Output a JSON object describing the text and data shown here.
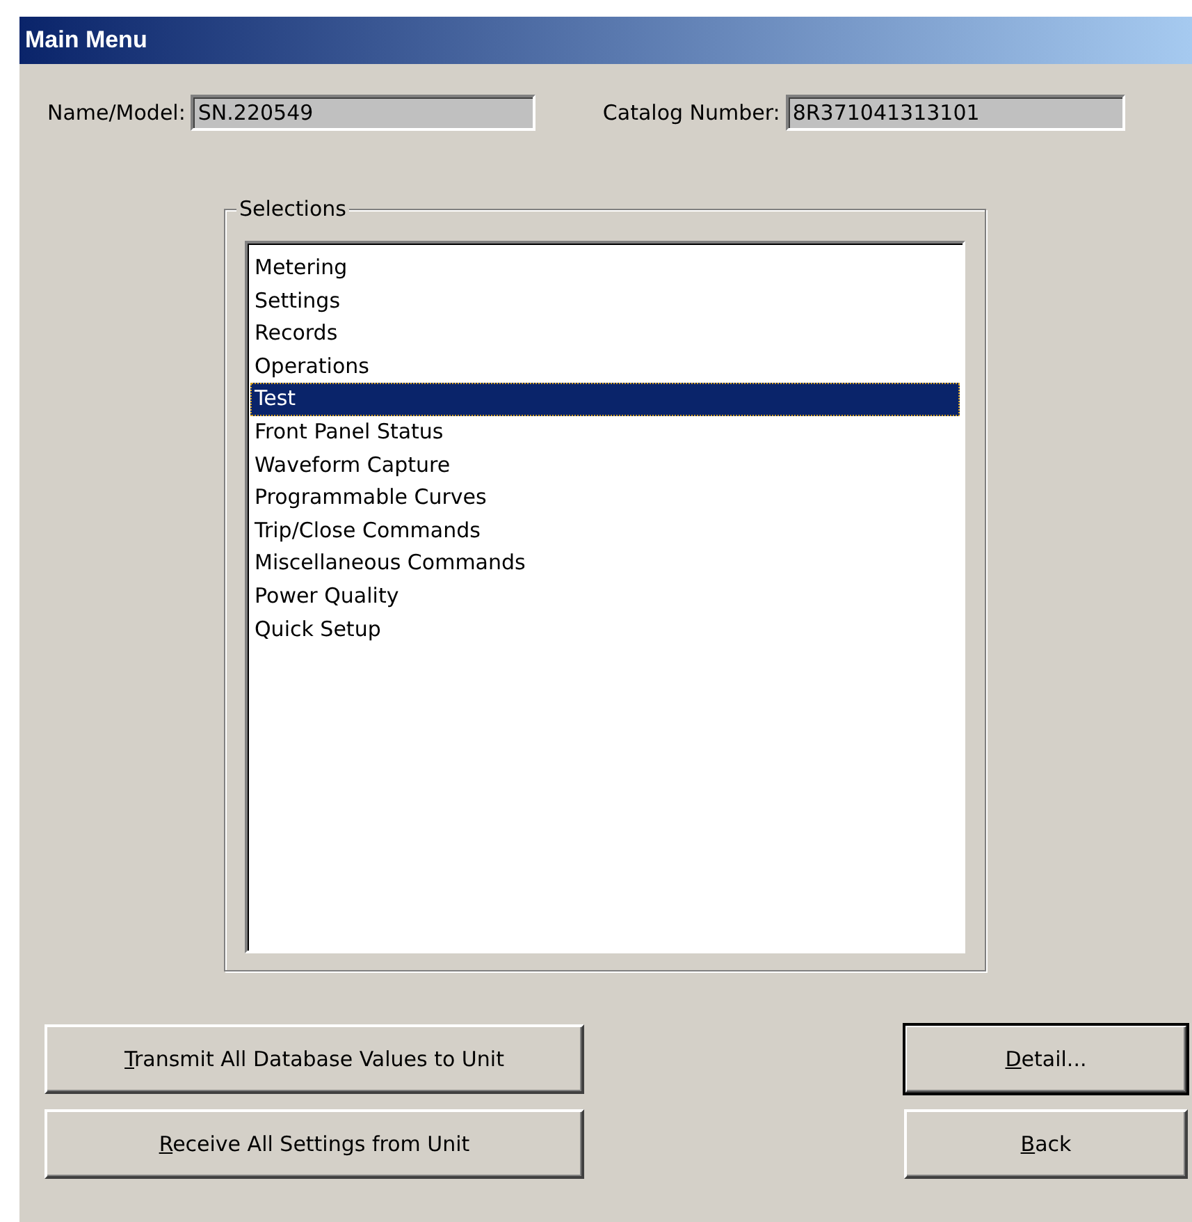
{
  "window": {
    "title": "Main Menu"
  },
  "fields": [
    {
      "label": "Name/Model:",
      "value": "SN.220549"
    },
    {
      "label": "Catalog Number:",
      "value": "8R371041313101"
    }
  ],
  "selections": {
    "title": "Selections",
    "items": [
      {
        "label": "Metering",
        "selected": false
      },
      {
        "label": "Settings",
        "selected": false
      },
      {
        "label": "Records",
        "selected": false
      },
      {
        "label": "Operations",
        "selected": false
      },
      {
        "label": "Test",
        "selected": true
      },
      {
        "label": "Front Panel Status",
        "selected": false
      },
      {
        "label": "Waveform Capture",
        "selected": false
      },
      {
        "label": "Programmable Curves",
        "selected": false
      },
      {
        "label": "Trip/Close Commands",
        "selected": false
      },
      {
        "label": "Miscellaneous Commands",
        "selected": false
      },
      {
        "label": "Power Quality",
        "selected": false
      },
      {
        "label": "Quick Setup",
        "selected": false
      }
    ]
  },
  "buttons": [
    {
      "label": "Transmit All Database Values to Unit",
      "mnemonic_first_letter": true,
      "default": false
    },
    {
      "label": "Detail...",
      "mnemonic_first_letter": true,
      "default": true
    },
    {
      "label": "Receive All Settings from Unit",
      "mnemonic_first_letter": true,
      "default": false
    },
    {
      "label": "Back",
      "mnemonic_first_letter": true,
      "default": false
    }
  ]
}
